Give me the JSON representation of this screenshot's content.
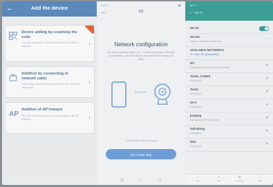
{
  "add_device": {
    "back_icon": "arrow-left-icon",
    "title": "Add the device",
    "options": [
      {
        "icon": "qr-code-icon",
        "title": "Device adding by scanning the code",
        "desc": "You can scan the code in the device to add the camera",
        "highlighted": true
      },
      {
        "icon": "network-cable-icon",
        "title": "Addition by connecting to network cable",
        "desc": "The device should be connected to the network cable first"
      },
      {
        "icon": "ap-hotspot-icon",
        "icon_text": "AP",
        "title": "Addition of AP hotspot",
        "desc": "You can add the device by connecting to its AP hotspot"
      }
    ]
  },
  "network_config": {
    "status_time": "10:17",
    "back_icon": "arrow-left-icon",
    "step": "1/3",
    "title": "Network configuration",
    "description": "The device indicator light is on. Connect it to power. If the light is not flashing, reset the device and wait for the indicator to flash",
    "tip": "The indicator light is flashing",
    "next_button": "Go to next step",
    "bottom_icons": [
      "menu-icon",
      "home-icon",
      "back-icon"
    ]
  },
  "settings": {
    "status": "10:17",
    "title": "Wi-Fi",
    "back_icon": "arrow-left-icon",
    "rows": [
      {
        "title": "WLAN",
        "sub": "",
        "control": "toggle"
      },
      {
        "title": "WLAN+",
        "sub": "Improve Internet experience",
        "control": "chevron"
      },
      {
        "title": "AVAILABLE NETWORKS",
        "sub": "TP-LINK_5G (Connected)",
        "control": "",
        "highlight": true
      },
      {
        "title": "IPC",
        "sub": "Encrypted (available for connection)",
        "control": "wifi"
      },
      {
        "title": "Tenda_2748D6",
        "sub": "Encrypted",
        "control": "wifi"
      },
      {
        "title": "Tenda",
        "sub": "Encrypted",
        "control": "wifi"
      },
      {
        "title": "ZK-5",
        "sub": "Encrypted",
        "control": "wifi"
      },
      {
        "title": "jumping",
        "sub": "Encrypted (WPS available)",
        "control": "wifi"
      },
      {
        "title": "beihaitong",
        "sub": "Encrypted",
        "control": "wifi"
      },
      {
        "title": "ithm",
        "sub": "Encrypted",
        "control": "wifi"
      }
    ],
    "bottom_nav": [
      {
        "icon": "search-icon",
        "label": "Scan"
      },
      {
        "icon": "plus-icon",
        "label": "Add"
      },
      {
        "icon": "config-icon",
        "label": "Configure"
      },
      {
        "icon": "more-icon",
        "label": "More"
      }
    ]
  }
}
